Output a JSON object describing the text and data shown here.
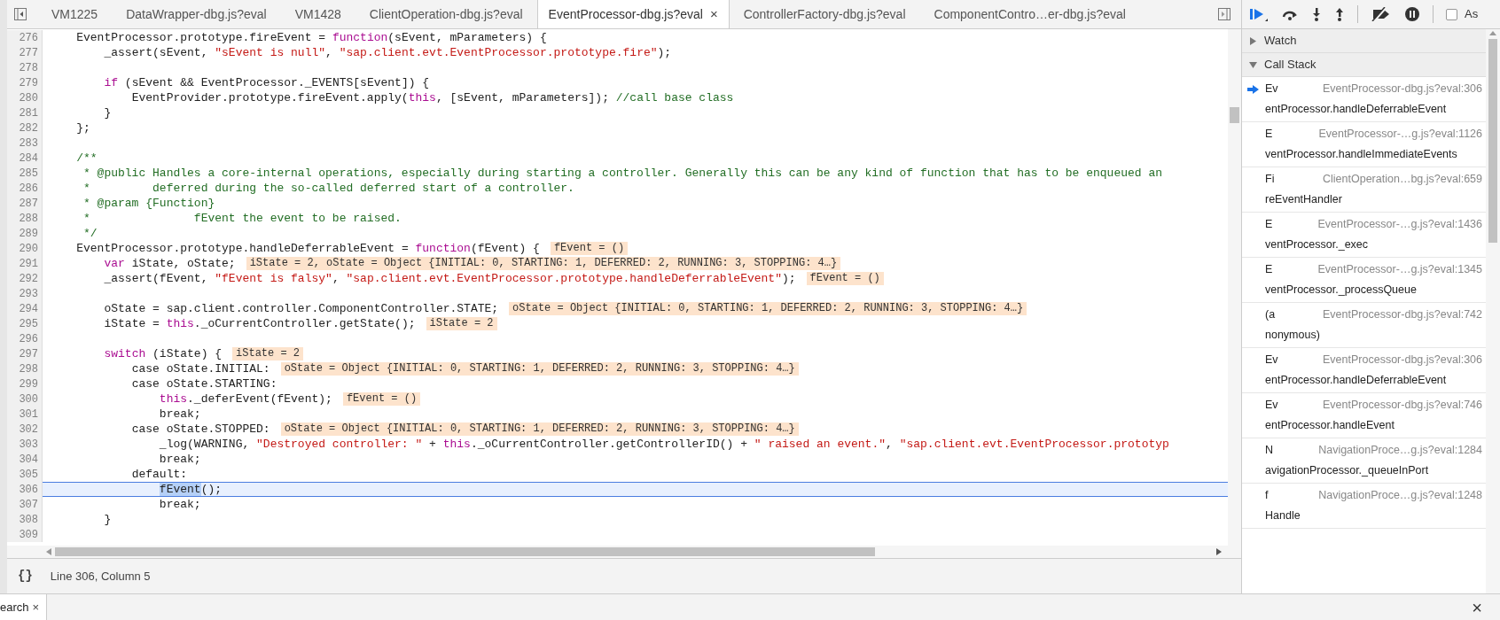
{
  "editor_tabs": [
    {
      "label": "VM1225",
      "selected": false
    },
    {
      "label": "DataWrapper-dbg.js?eval",
      "selected": false
    },
    {
      "label": "VM1428",
      "selected": false
    },
    {
      "label": "ClientOperation-dbg.js?eval",
      "selected": false
    },
    {
      "label": "EventProcessor-dbg.js?eval",
      "selected": true,
      "close": "×"
    },
    {
      "label": "ControllerFactory-dbg.js?eval",
      "selected": false
    },
    {
      "label": "ComponentContro…er-dbg.js?eval",
      "selected": false
    }
  ],
  "code": {
    "lines": [
      {
        "number": "276",
        "selected": false,
        "segments": [
          {
            "kind": "plain",
            "text": "    EventProcessor.prototype.fireEvent = "
          },
          {
            "kind": "keyword",
            "text": "function"
          },
          {
            "kind": "plain",
            "text": "(sEvent, mParameters) {"
          }
        ]
      },
      {
        "number": "277",
        "selected": false,
        "segments": [
          {
            "kind": "plain",
            "text": "        _assert(sEvent, "
          },
          {
            "kind": "string",
            "text": "\"sEvent is null\""
          },
          {
            "kind": "plain",
            "text": ", "
          },
          {
            "kind": "string",
            "text": "\"sap.client.evt.EventProcessor.prototype.fire\""
          },
          {
            "kind": "plain",
            "text": ");"
          }
        ]
      },
      {
        "number": "278",
        "selected": false
      },
      {
        "number": "279",
        "selected": false,
        "segments": [
          {
            "kind": "keyword",
            "text": "        if"
          },
          {
            "kind": "plain",
            "text": " (sEvent && EventProcessor._EVENTS[sEvent]) {"
          }
        ]
      },
      {
        "number": "280",
        "selected": false,
        "segments": [
          {
            "kind": "plain",
            "text": "            EventProvider.prototype.fireEvent.apply("
          },
          {
            "kind": "keyword",
            "text": "this"
          },
          {
            "kind": "plain",
            "text": ", [sEvent, mParameters]); "
          },
          {
            "kind": "comment",
            "text": "//call base class"
          }
        ]
      },
      {
        "number": "281",
        "selected": false,
        "segments": [
          {
            "kind": "plain",
            "text": "        }"
          }
        ]
      },
      {
        "number": "282",
        "selected": false,
        "segments": [
          {
            "kind": "plain",
            "text": "    };"
          }
        ]
      },
      {
        "number": "283",
        "selected": false
      },
      {
        "number": "284",
        "selected": false,
        "segments": [
          {
            "kind": "comment",
            "text": "    /**"
          }
        ]
      },
      {
        "number": "285",
        "selected": false,
        "segments": [
          {
            "kind": "comment",
            "text": "     * @public Handles a core-internal operations, especially during starting a controller. Generally this can be any kind of function that has to be enqueued an"
          }
        ]
      },
      {
        "number": "286",
        "selected": false,
        "segments": [
          {
            "kind": "comment",
            "text": "     *         deferred during the so-called deferred start of a controller."
          }
        ]
      },
      {
        "number": "287",
        "selected": false,
        "segments": [
          {
            "kind": "comment",
            "text": "     * @param {Function}"
          }
        ]
      },
      {
        "number": "288",
        "selected": false,
        "segments": [
          {
            "kind": "comment",
            "text": "     *               fEvent the event to be raised."
          }
        ]
      },
      {
        "number": "289",
        "selected": false,
        "segments": [
          {
            "kind": "comment",
            "text": "     */"
          }
        ]
      },
      {
        "number": "290",
        "selected": false,
        "segments": [
          {
            "kind": "plain",
            "text": "    EventProcessor.prototype.handleDeferrableEvent = "
          },
          {
            "kind": "keyword",
            "text": "function"
          },
          {
            "kind": "plain",
            "text": "(fEvent) {"
          }
        ],
        "inline_value": "fEvent = ()"
      },
      {
        "number": "291",
        "selected": false,
        "segments": [
          {
            "kind": "keyword",
            "text": "        var"
          },
          {
            "kind": "plain",
            "text": " iState, oState;"
          }
        ],
        "inline_value": "iState = 2, oState = Object {INITIAL: 0, STARTING: 1, DEFERRED: 2, RUNNING: 3, STOPPING: 4…}"
      },
      {
        "number": "292",
        "selected": false,
        "segments": [
          {
            "kind": "plain",
            "text": "        _assert(fEvent, "
          },
          {
            "kind": "string",
            "text": "\"fEvent is falsy\""
          },
          {
            "kind": "plain",
            "text": ", "
          },
          {
            "kind": "string",
            "text": "\"sap.client.evt.EventProcessor.prototype.handleDeferrableEvent\""
          },
          {
            "kind": "plain",
            "text": ");"
          }
        ],
        "inline_value": "fEvent = ()"
      },
      {
        "number": "293",
        "selected": false
      },
      {
        "number": "294",
        "selected": false,
        "segments": [
          {
            "kind": "plain",
            "text": "        oState = sap.client.controller.ComponentController.STATE;"
          }
        ],
        "inline_value": "oState = Object {INITIAL: 0, STARTING: 1, DEFERRED: 2, RUNNING: 3, STOPPING: 4…}"
      },
      {
        "number": "295",
        "selected": false,
        "segments": [
          {
            "kind": "plain",
            "text": "        iState = "
          },
          {
            "kind": "keyword",
            "text": "this"
          },
          {
            "kind": "plain",
            "text": "._oCurrentController.getState();"
          }
        ],
        "inline_value": "iState = 2"
      },
      {
        "number": "296",
        "selected": false
      },
      {
        "number": "297",
        "selected": false,
        "segments": [
          {
            "kind": "keyword",
            "text": "        switch"
          },
          {
            "kind": "plain",
            "text": " (iState) {"
          }
        ],
        "inline_value": "iState = 2"
      },
      {
        "number": "298",
        "selected": false,
        "segments": [
          {
            "kind": "plain",
            "text": "            case oState.INITIAL:"
          }
        ],
        "inline_value": "oState = Object {INITIAL: 0, STARTING: 1, DEFERRED: 2, RUNNING: 3, STOPPING: 4…}"
      },
      {
        "number": "299",
        "selected": false,
        "segments": [
          {
            "kind": "plain",
            "text": "            case oState.STARTING:"
          }
        ]
      },
      {
        "number": "300",
        "selected": false,
        "segments": [
          {
            "kind": "keyword",
            "text": "                this"
          },
          {
            "kind": "plain",
            "text": "._deferEvent(fEvent);"
          }
        ],
        "inline_value": "fEvent = ()"
      },
      {
        "number": "301",
        "selected": false,
        "segments": [
          {
            "kind": "plain",
            "text": "                break;"
          }
        ]
      },
      {
        "number": "302",
        "selected": false,
        "segments": [
          {
            "kind": "plain",
            "text": "            case oState.STOPPED:"
          }
        ],
        "inline_value": "oState = Object {INITIAL: 0, STARTING: 1, DEFERRED: 2, RUNNING: 3, STOPPING: 4…}"
      },
      {
        "number": "303",
        "selected": false,
        "segments": [
          {
            "kind": "plain",
            "text": "                _log(WARNING, "
          },
          {
            "kind": "string",
            "text": "\"Destroyed controller: \""
          },
          {
            "kind": "plain",
            "text": " + "
          },
          {
            "kind": "keyword",
            "text": "this"
          },
          {
            "kind": "plain",
            "text": "._oCurrentController.getControllerID() + "
          },
          {
            "kind": "string",
            "text": "\" raised an event.\""
          },
          {
            "kind": "plain",
            "text": ", "
          },
          {
            "kind": "string",
            "text": "\"sap.client.evt.EventProcessor.prototyp"
          }
        ]
      },
      {
        "number": "304",
        "selected": false,
        "segments": [
          {
            "kind": "plain",
            "text": "                break;"
          }
        ]
      },
      {
        "number": "305",
        "selected": false,
        "segments": [
          {
            "kind": "plain",
            "text": "            default:"
          }
        ]
      },
      {
        "number": "306",
        "selected": true,
        "segments": [
          {
            "kind": "selection",
            "text": "                fEvent"
          },
          {
            "kind": "plain",
            "text": "();"
          }
        ]
      },
      {
        "number": "307",
        "selected": false,
        "segments": [
          {
            "kind": "plain",
            "text": "                break;"
          }
        ]
      },
      {
        "number": "308",
        "selected": false,
        "segments": [
          {
            "kind": "plain",
            "text": "        }"
          }
        ]
      },
      {
        "number": "309",
        "selected": false
      }
    ]
  },
  "status_bar": {
    "pretty_print": "{}",
    "position": "Line 306, Column 5"
  },
  "debugger_toolbar": {
    "async": {
      "label": "As",
      "checked": false
    }
  },
  "watch": {
    "title": "Watch",
    "expanded": false
  },
  "call_stack": {
    "title": "Call Stack",
    "expanded": true,
    "frames": [
      {
        "name_head": "Ev",
        "name_tail": "entProcessor.handleDeferrableEvent",
        "location": "EventProcessor-dbg.js?eval:306",
        "selected": true
      },
      {
        "name_head": "E",
        "name_tail": "ventProcessor.handleImmediateEvents",
        "location": "EventProcessor-…g.js?eval:1126",
        "selected": false
      },
      {
        "name_head": "Fi",
        "name_tail": "reEventHandler",
        "location": "ClientOperation…bg.js?eval:659",
        "selected": false
      },
      {
        "name_head": "E",
        "name_tail": "ventProcessor._exec",
        "location": "EventProcessor-…g.js?eval:1436",
        "selected": false
      },
      {
        "name_head": "E",
        "name_tail": "ventProcessor._processQueue",
        "location": "EventProcessor-…g.js?eval:1345",
        "selected": false
      },
      {
        "name_head": "(a",
        "name_tail": "nonymous)",
        "location": "EventProcessor-dbg.js?eval:742",
        "selected": false
      },
      {
        "name_head": "Ev",
        "name_tail": "entProcessor.handleDeferrableEvent",
        "location": "EventProcessor-dbg.js?eval:306",
        "selected": false
      },
      {
        "name_head": "Ev",
        "name_tail": "entProcessor.handleEvent",
        "location": "EventProcessor-dbg.js?eval:746",
        "selected": false
      },
      {
        "name_head": "N",
        "name_tail": "avigationProcessor._queueInPort",
        "location": "NavigationProce…g.js?eval:1284",
        "selected": false
      },
      {
        "name_head": "f",
        "name_tail": "Handle",
        "location": "NavigationProce…g.js?eval:1248",
        "selected": false
      }
    ]
  },
  "drawer": {
    "tab": {
      "label": "earch",
      "close": "×"
    },
    "close": "×"
  }
}
